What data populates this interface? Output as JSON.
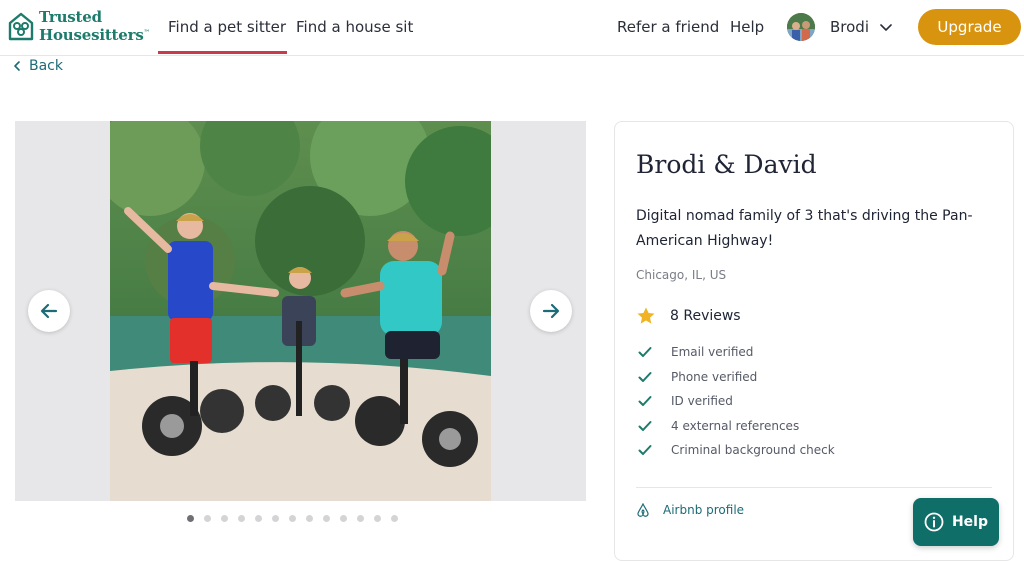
{
  "header": {
    "logo_line1": "Trusted",
    "logo_line2": "Housesitters",
    "logo_tm": "™",
    "nav": [
      {
        "label": "Find a pet sitter",
        "active": true
      },
      {
        "label": "Find a house sit",
        "active": false
      }
    ],
    "refer_label": "Refer a friend",
    "help_label": "Help",
    "user_name": "Brodi",
    "upgrade_label": "Upgrade"
  },
  "back_label": "Back",
  "gallery": {
    "slide_count": 13,
    "active_index": 0,
    "prev_icon": "arrow-left-icon",
    "next_icon": "arrow-right-icon"
  },
  "profile": {
    "title": "Brodi & David",
    "description": "Digital nomad family of 3 that's driving the Pan-American Highway!",
    "location": "Chicago, IL, US",
    "reviews": "8 Reviews",
    "checks": [
      "Email verified",
      "Phone verified",
      "ID verified",
      "4 external references",
      "Criminal background check"
    ],
    "airbnb_label": "Airbnb profile"
  },
  "help_button": "Help",
  "colors": {
    "brand": "#1c7b6b",
    "accent": "#d8940f",
    "nav_active": "#c93b4b",
    "link": "#1c6b77",
    "help_bg": "#0f6e68"
  }
}
